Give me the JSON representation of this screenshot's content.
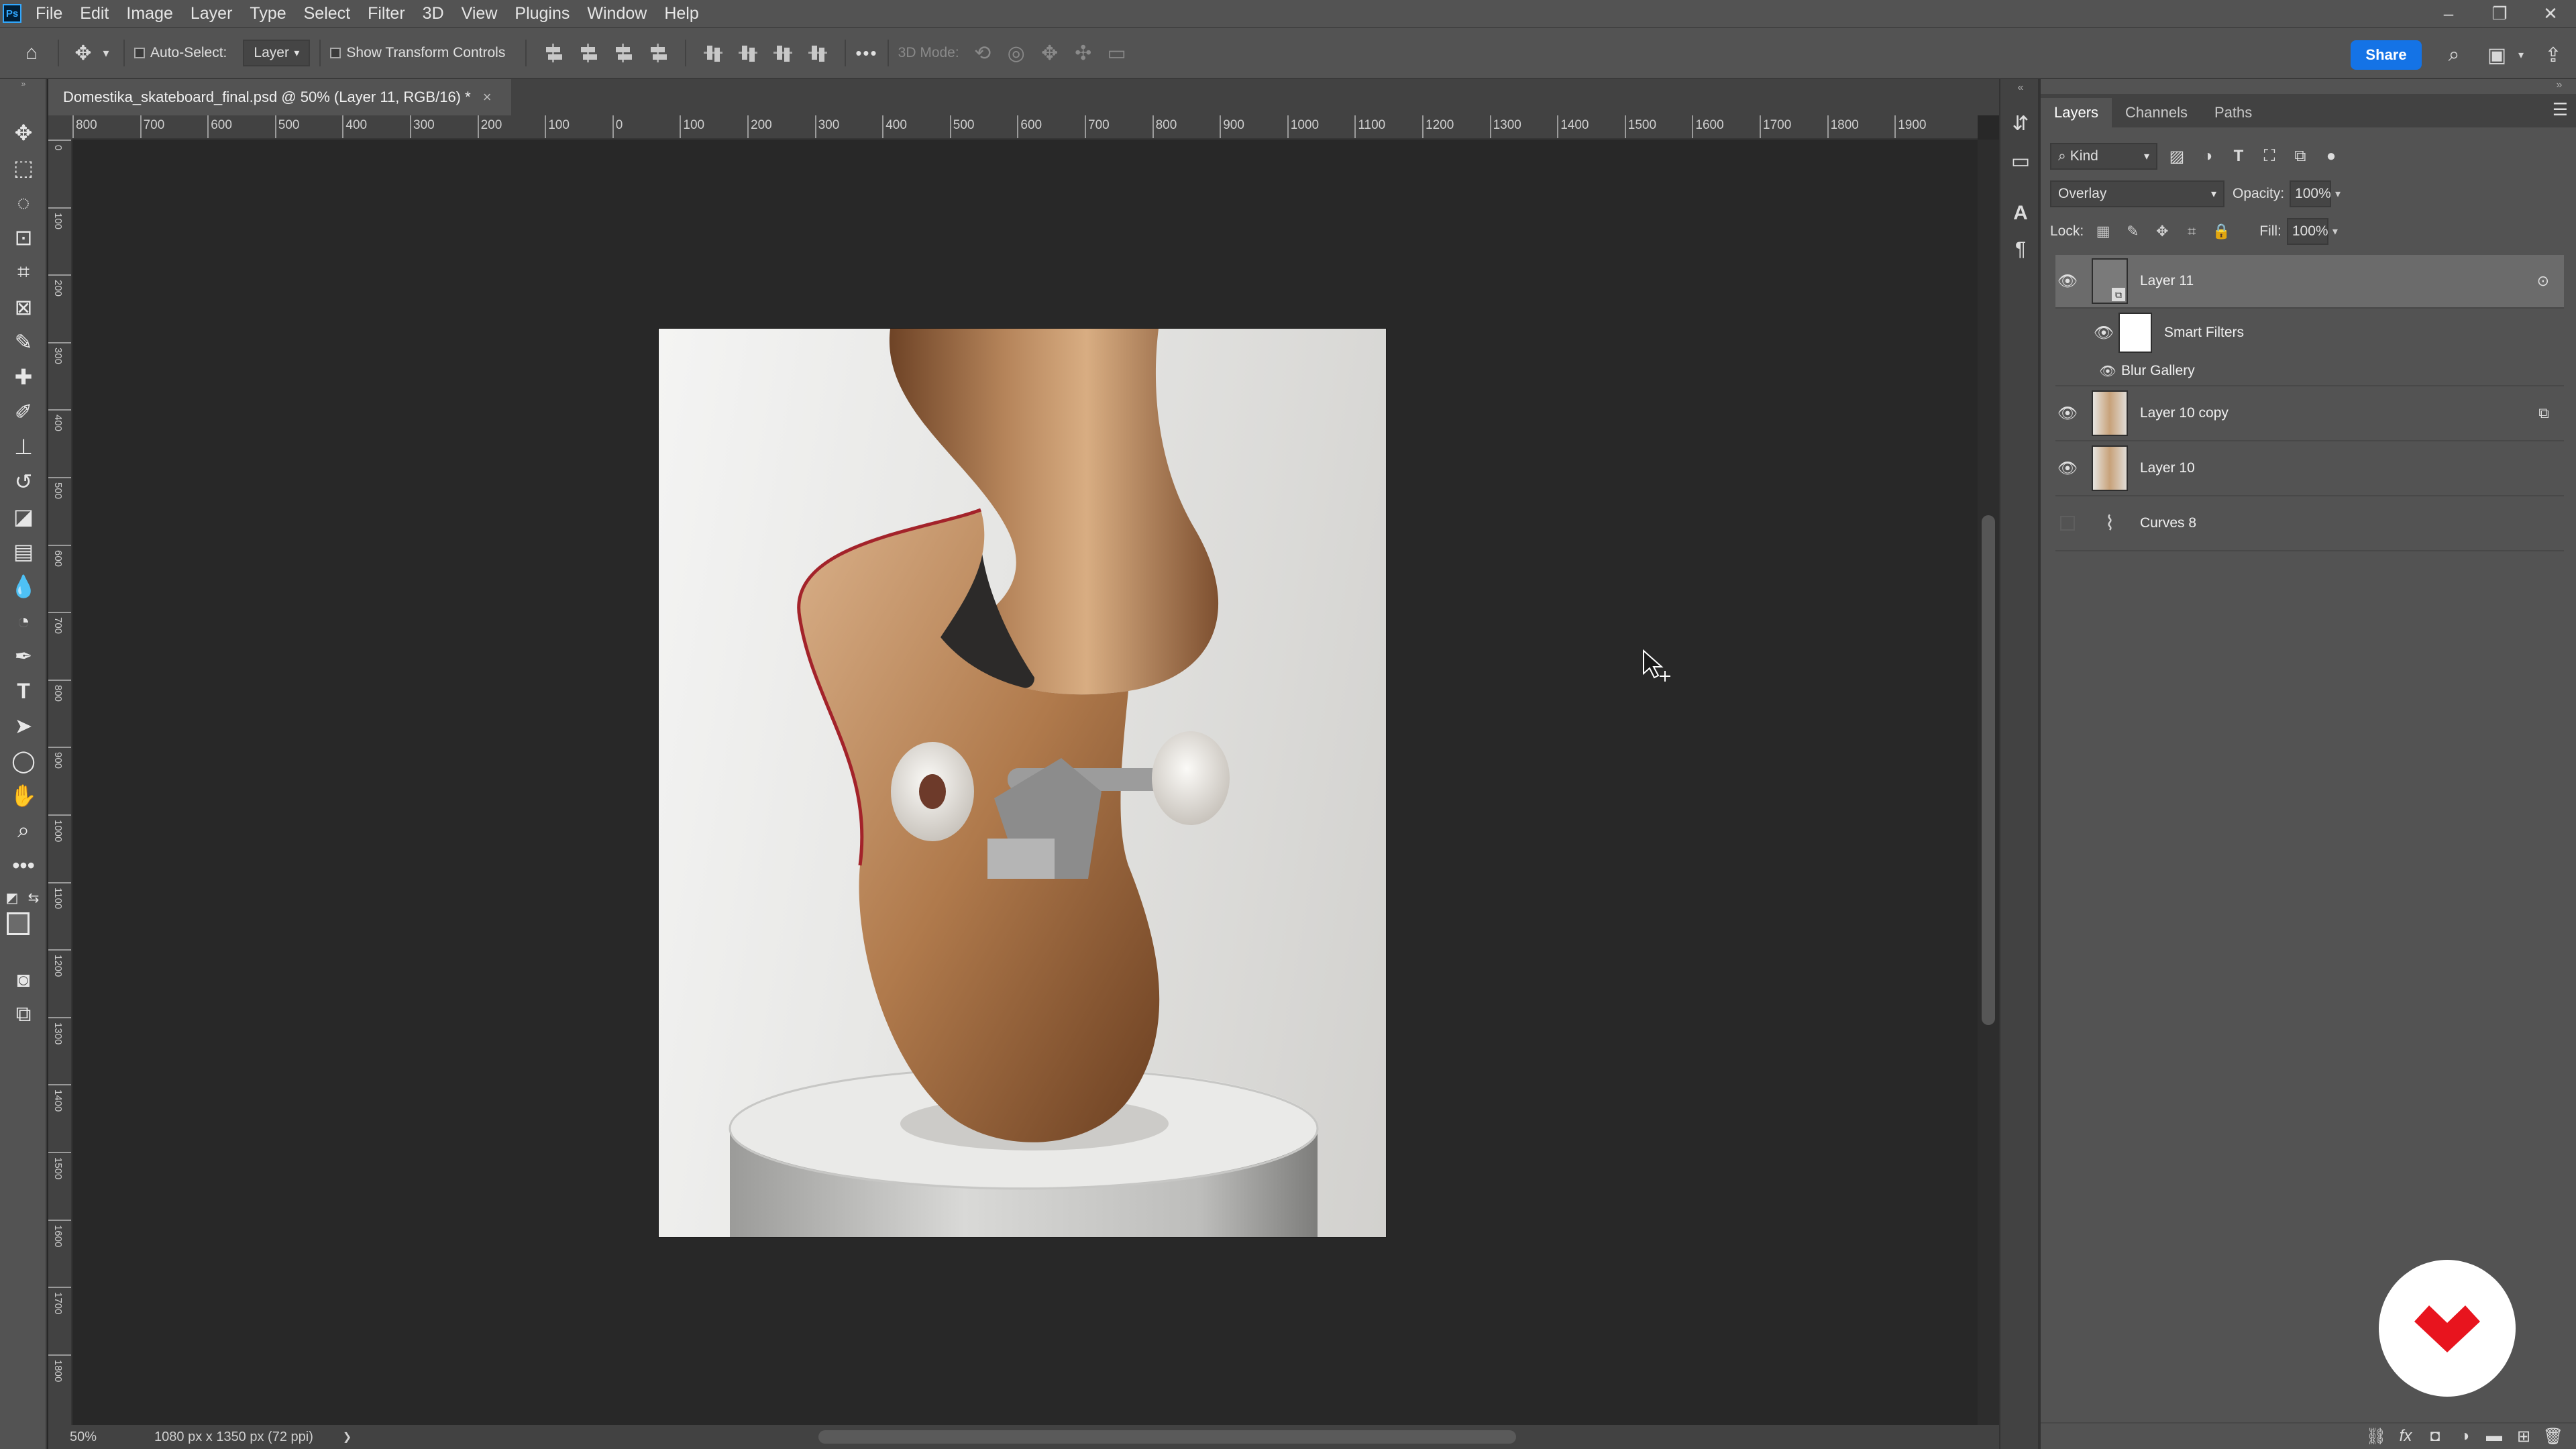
{
  "app": {
    "logo": "Ps"
  },
  "menu": [
    "File",
    "Edit",
    "Image",
    "Layer",
    "Type",
    "Select",
    "Filter",
    "3D",
    "View",
    "Plugins",
    "Window",
    "Help"
  ],
  "window_controls": {
    "minimize": "–",
    "restore": "❐",
    "close": "✕"
  },
  "options_bar": {
    "auto_select_label": "Auto-Select:",
    "auto_select_value": "Layer",
    "show_transform_label": "Show Transform Controls",
    "more": "•••",
    "mode_3d_label": "3D Mode:",
    "share_label": "Share"
  },
  "document": {
    "tab_title": "Domestika_skateboard_final.psd @ 50% (Layer 11, RGB/16) *",
    "tab_close": "×",
    "zoom": "50%",
    "dimensions": "1080 px x 1350 px (72 ppi)",
    "status_arrow": "❯"
  },
  "ruler_top_labels": [
    "800",
    "700",
    "600",
    "500",
    "400",
    "300",
    "200",
    "100",
    "0",
    "100",
    "200",
    "300",
    "400",
    "500",
    "600",
    "700",
    "800",
    "900",
    "1000",
    "1100",
    "1200",
    "1300",
    "1400",
    "1500",
    "1600",
    "1700",
    "1800",
    "1900"
  ],
  "ruler_left_labels": [
    "0",
    "100",
    "200",
    "300",
    "400",
    "500",
    "600",
    "700",
    "800",
    "900",
    "1000",
    "1100",
    "1200",
    "1300",
    "1400",
    "1500",
    "1600",
    "1700",
    "1800"
  ],
  "panels": {
    "tabs": [
      "Layers",
      "Channels",
      "Paths"
    ],
    "active_tab": "Layers",
    "filter_kind": "Kind",
    "blend_mode": "Overlay",
    "opacity_label": "Opacity:",
    "opacity_value": "100%",
    "lock_label": "Lock:",
    "fill_label": "Fill:",
    "fill_value": "100%"
  },
  "layers": [
    {
      "name": "Layer 11",
      "visible": true,
      "selected": true,
      "type": "smart-object"
    },
    {
      "name": "Smart Filters",
      "visible": true,
      "type": "smart-filters"
    },
    {
      "name": "Blur Gallery",
      "visible": true,
      "type": "filter"
    },
    {
      "name": "Layer 10 copy",
      "visible": true,
      "type": "pixel"
    },
    {
      "name": "Layer 10",
      "visible": true,
      "type": "pixel"
    },
    {
      "name": "Curves 8",
      "visible": false,
      "type": "adjustment"
    }
  ],
  "colors": {
    "chrome": "#535353",
    "canvas_bg": "#282828",
    "accent": "#1473e6",
    "domestika_red": "#e8141e",
    "foreground": "#6b6b6b",
    "background": "#ffffff"
  }
}
